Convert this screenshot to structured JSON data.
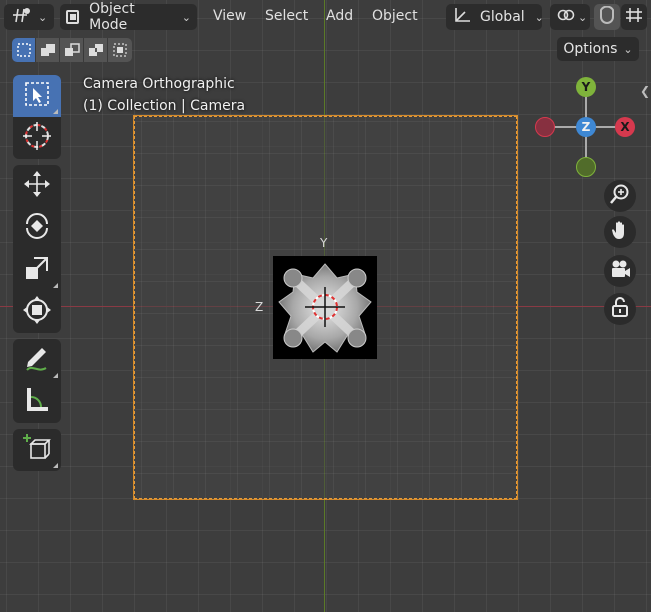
{
  "header": {
    "editor_type_icon": "transform-icon",
    "mode_label": "Object Mode",
    "menus": [
      "View",
      "Select",
      "Add",
      "Object"
    ],
    "orientation_label": "Global",
    "snap_icon": "magnet-icon",
    "grid_icon": "snap-grid-icon",
    "pivot_icon": "pivot-icon",
    "link_icon": "link-icon"
  },
  "select_modes": [
    "select-new-icon",
    "select-extend-icon",
    "select-subtract-icon",
    "select-difference-icon",
    "select-intersect-icon"
  ],
  "options_label": "Options",
  "viewport": {
    "view_name": "Camera Orthographic",
    "collection_info": "(1) Collection | Camera",
    "axis_label_y": "Y",
    "axis_label_z": "Z"
  },
  "toolbar": [
    [
      "select-box-icon",
      "cursor-icon"
    ],
    [
      "move-icon",
      "rotate-icon",
      "scale-icon",
      "transform-icon"
    ],
    [
      "annotate-icon",
      "measure-icon"
    ],
    [
      "add-cube-icon"
    ]
  ],
  "gizmo": {
    "y_label": "Y",
    "z_label": "Z",
    "x_label": "X",
    "colors": {
      "x": "#d6394e",
      "y": "#7fb33b",
      "z": "#3e88d4"
    }
  },
  "nav_buttons": [
    "zoom-icon",
    "pan-hand-icon",
    "camera-icon",
    "lock-icon"
  ],
  "colors": {
    "active_blue": "#4772b3",
    "camera_frame": "#e59a3a",
    "x_axis_line": "#8a3a44",
    "y_axis_line": "#5b7a28"
  }
}
